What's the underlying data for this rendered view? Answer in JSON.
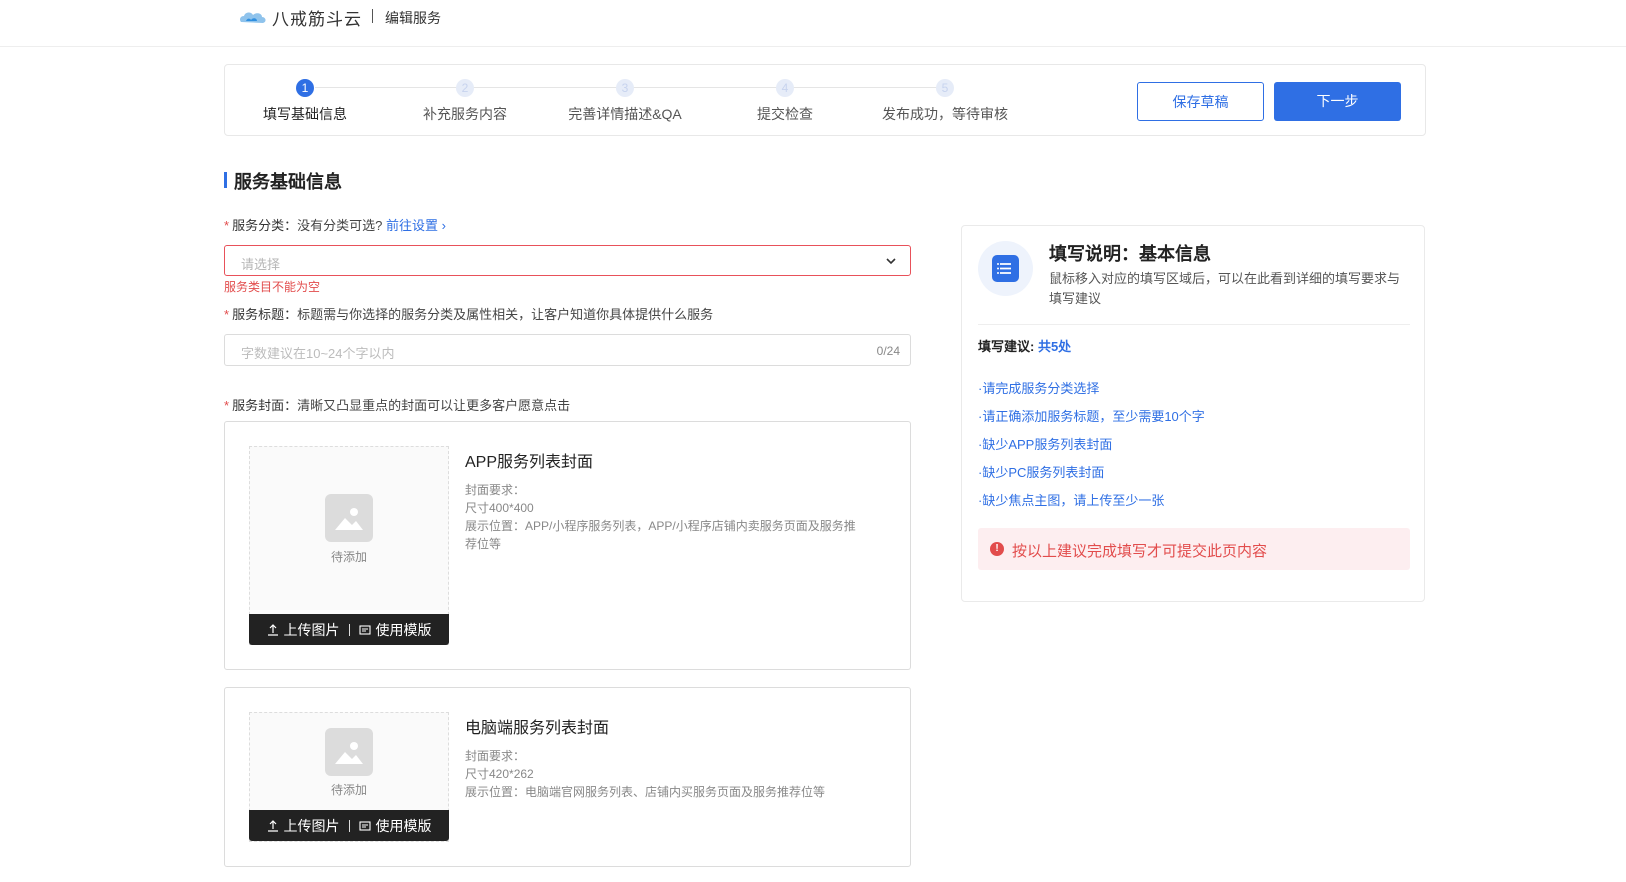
{
  "header": {
    "logo_text": "八戒筋斗云",
    "title": "编辑服务"
  },
  "steps": [
    {
      "num": "1",
      "label": "填写基础信息",
      "active": true
    },
    {
      "num": "2",
      "label": "补充服务内容",
      "active": false
    },
    {
      "num": "3",
      "label": "完善详情描述&QA",
      "active": false
    },
    {
      "num": "4",
      "label": "提交检查",
      "active": false
    },
    {
      "num": "5",
      "label": "发布成功，等待审核",
      "active": false
    }
  ],
  "actions": {
    "save_draft": "保存草稿",
    "next": "下一步"
  },
  "section": {
    "title": "服务基础信息"
  },
  "category": {
    "required": "*",
    "label": "服务分类：",
    "hint": "没有分类可选?",
    "link": "前往设置",
    "placeholder": "请选择",
    "error": "服务类目不能为空"
  },
  "service_title": {
    "required": "*",
    "label": "服务标题：",
    "hint": "标题需与你选择的服务分类及属性相关，让客户知道你具体提供什么服务",
    "placeholder": "字数建议在10~24个字以内",
    "count": "0/24"
  },
  "cover": {
    "required": "*",
    "label": "服务封面：",
    "hint": "清晰又凸显重点的封面可以让更多客户愿意点击",
    "pending": "待添加",
    "upload_label": "上传图片",
    "template_label": "使用模版",
    "items": [
      {
        "title": "APP服务列表封面",
        "req": "封面要求：",
        "size": "尺寸400*400",
        "position": "展示位置：APP/小程序服务列表，APP/小程序店铺内卖服务页面及服务推荐位等"
      },
      {
        "title": "电脑端服务列表封面",
        "req": "封面要求：",
        "size": "尺寸420*262",
        "position": "展示位置：电脑端官网服务列表、店铺内买服务页面及服务推荐位等"
      }
    ]
  },
  "tips": {
    "title": "填写说明：基本信息",
    "desc": "鼠标移入对应的填写区域后，可以在此看到详细的填写要求与填写建议",
    "sugg_label": "填写建议: ",
    "sugg_count": "共5处",
    "items": [
      "·请完成服务分类选择",
      "·请正确添加服务标题，至少需要10个字",
      "·缺少APP服务列表封面",
      "·缺少PC服务列表封面",
      "·缺少焦点主图，请上传至少一张"
    ],
    "warning": "按以上建议完成填写才可提交此页内容"
  },
  "colors": {
    "accent": "#2f6fe4",
    "error": "#e24c4c"
  }
}
